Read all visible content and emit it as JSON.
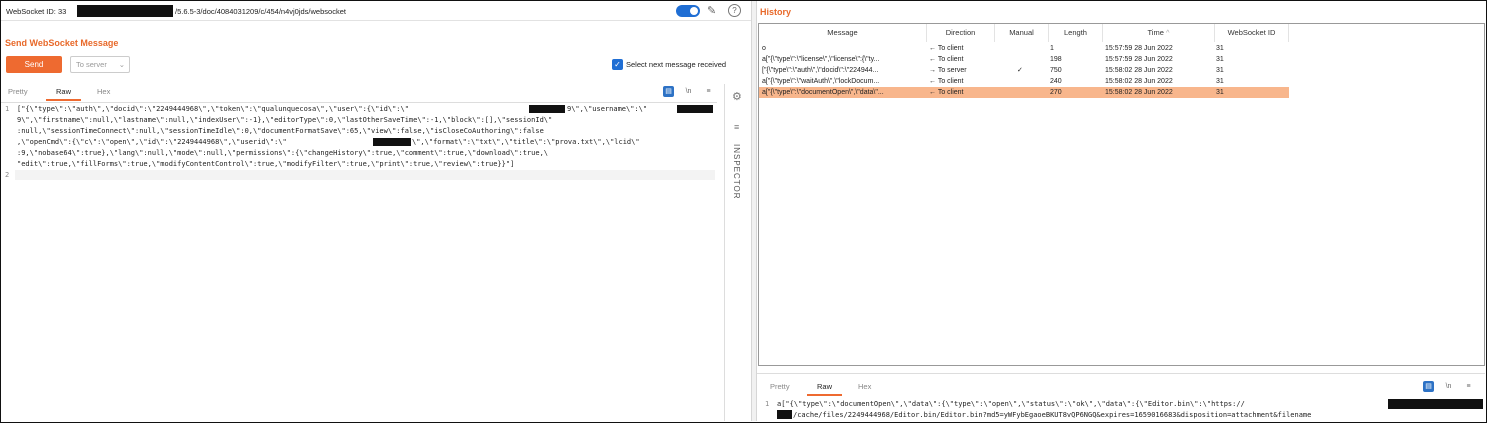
{
  "left": {
    "ws_id_label": "WebSocket ID: 33 ",
    "ws_url": "/5.6.5-3/doc/4084031209/c/454/n4vj0jds/websocket",
    "section_title": "Send WebSocket Message",
    "send_label": "Send",
    "target_select": "To server",
    "select_next_label": "Select next message received",
    "tabs": [
      "Pretty",
      "Raw",
      "Hex"
    ],
    "tool_icons": [
      "\\n",
      "≡"
    ],
    "code_lines": [
      "[\"{\\\"type\\\":\\\"auth\\\",\\\"docid\\\":\\\"2249444968\\\",\\\"token\\\":\\\"qualunquecosa\\\",\\\"user\\\":{\\\"id\\\":\\\"",
      "9\\\",\\\"firstname\\\":null,\\\"lastname\\\":null,\\\"indexUser\\\":-1},\\\"editorType\\\":0,\\\"lastOtherSaveTime\\\":-1,\\\"block\\\":[],\\\"sessionId\\\"",
      ":null,\\\"sessionTimeConnect\\\":null,\\\"sessionTimeIdle\\\":0,\\\"documentFormatSave\\\":65,\\\"view\\\":false,\\\"isCloseCoAuthoring\\\":false",
      ",\\\"openCmd\\\":{\\\"c\\\":\\\"open\\\",\\\"id\\\":\\\"2249444968\\\",\\\"userid\\\":\\\"",
      ":9,\\\"nobase64\\\":true},\\\"lang\\\":null,\\\"mode\\\":null,\\\"permissions\\\":{\\\"changeHistory\\\":true,\\\"comment\\\":true,\\\"download\\\":true,\\",
      "\"edit\\\":true,\\\"fillForms\\\":true,\\\"modifyContentControl\\\":true,\\\"modifyFilter\\\":true,\\\"print\\\":true,\\\"review\\\":true}}\"]"
    ],
    "code_line1_tail_a": "9\\\",\\\"username\\\":\\\"",
    "code_line4_tail": "\\\",\\\"format\\\":\\\"txt\\\",\\\"title\\\":\\\"prova.txt\\\",\\\"lcid\\\"",
    "line_numbers": [
      "1",
      "2"
    ],
    "inspector_label": "INSPECTOR"
  },
  "right": {
    "title": "History",
    "columns": [
      "Message",
      "Direction",
      "Manual",
      "Length",
      "Time",
      "WebSocket ID"
    ],
    "sort_indicator": "^",
    "rows": [
      {
        "message": "o",
        "direction": "← To client",
        "manual": "",
        "length": "1",
        "time": "15:57:59 28 Jun 2022",
        "wsid": "31"
      },
      {
        "message": "a[\"{\\\"type\\\":\\\"license\\\",\\\"license\\\":{\\\"ty...",
        "direction": "← To client",
        "manual": "",
        "length": "198",
        "time": "15:57:59 28 Jun 2022",
        "wsid": "31"
      },
      {
        "message": "[\"{\\\"type\\\":\\\"auth\\\",\\\"docid\\\":\\\"224944...",
        "direction": "→ To server",
        "manual": "✓",
        "length": "750",
        "time": "15:58:02 28 Jun 2022",
        "wsid": "31"
      },
      {
        "message": "a[\"{\\\"type\\\":\\\"waitAuth\\\",\\\"lockDocum...",
        "direction": "← To client",
        "manual": "",
        "length": "240",
        "time": "15:58:02 28 Jun 2022",
        "wsid": "31"
      },
      {
        "message": "a[\"{\\\"type\\\":\\\"documentOpen\\\",\\\"data\\\"...",
        "direction": "← To client",
        "manual": "",
        "length": "270",
        "time": "15:58:02 28 Jun 2022",
        "wsid": "31"
      }
    ],
    "selected_row": 4,
    "bottom_tabs": [
      "Pretty",
      "Raw",
      "Hex"
    ],
    "bottom_line_number": "1",
    "bottom_code_1": "a[\"{\\\"type\\\":\\\"documentOpen\\\",\\\"data\\\":{\\\"type\\\":\\\"open\\\",\\\"status\\\":\\\"ok\\\",\\\"data\\\":{\\\"Editor.bin\\\":\\\"https://",
    "bottom_code_2": "/cache/files/2249444968/Editor.bin/Editor.bin?md5=yWFybEgaoeBKUT8vQP6NGQ&expires=1659016683&disposition=attachment&filename"
  },
  "colors": {
    "accent": "#ee6a30",
    "toggle": "#1f6ed4",
    "selected_row": "#f8b68c"
  }
}
